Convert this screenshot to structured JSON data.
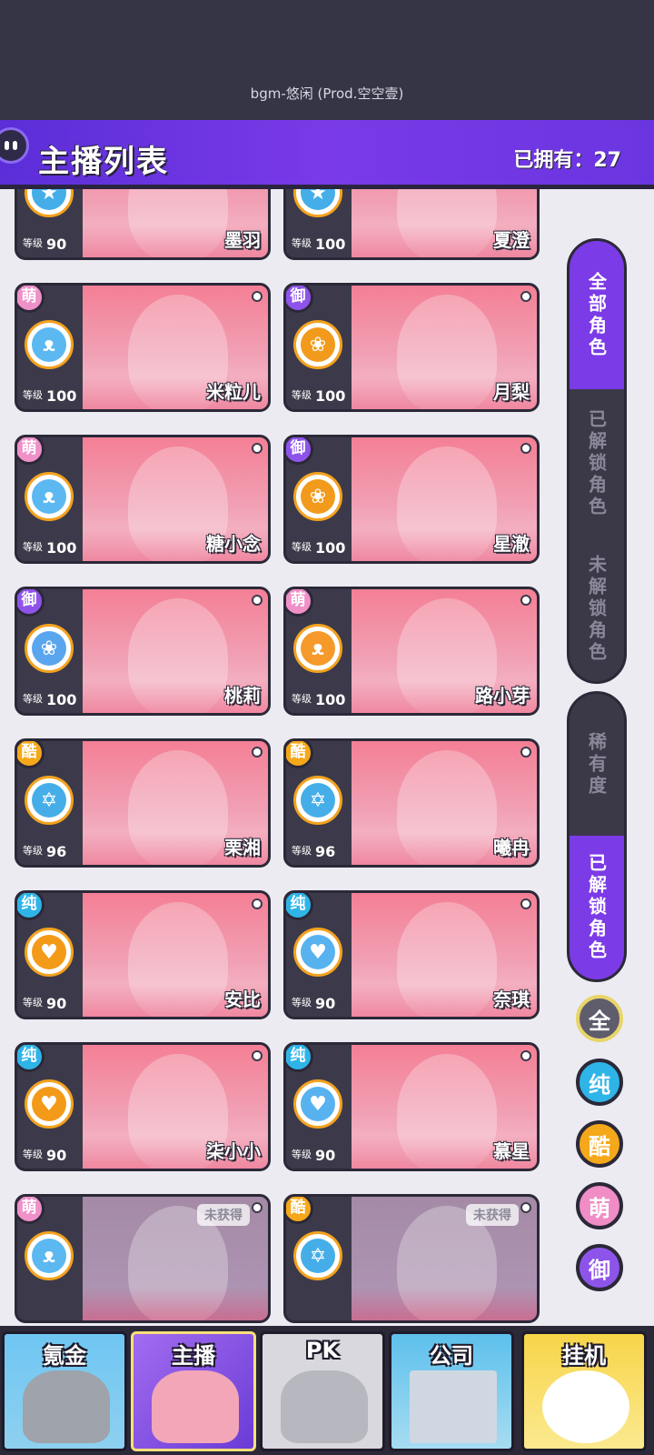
{
  "bgm": "bgm-悠闲 (Prod.空空壹)",
  "header": {
    "title": "主播列表",
    "owned": "已拥有：27"
  },
  "level_label": "等级",
  "unobtained_label": "未获得",
  "cards": [
    {
      "name": "墨羽",
      "level": "90",
      "rarity": "",
      "glyph": ""
    },
    {
      "name": "夏澄",
      "level": "100",
      "rarity": "",
      "glyph": ""
    },
    {
      "name": "米粒儿",
      "level": "100",
      "rarity": "萌",
      "glyph": "cat-icon"
    },
    {
      "name": "月梨",
      "level": "100",
      "rarity": "御",
      "glyph": "rose-icon"
    },
    {
      "name": "糖小念",
      "level": "100",
      "rarity": "萌",
      "glyph": "cat-icon"
    },
    {
      "name": "星澈",
      "level": "100",
      "rarity": "御",
      "glyph": "rose-icon"
    },
    {
      "name": "桃莉",
      "level": "100",
      "rarity": "御",
      "glyph": "rose-icon"
    },
    {
      "name": "路小芽",
      "level": "100",
      "rarity": "萌",
      "glyph": "cat-icon"
    },
    {
      "name": "栗湘",
      "level": "96",
      "rarity": "酷",
      "glyph": "star-icon"
    },
    {
      "name": "曦冉",
      "level": "96",
      "rarity": "酷",
      "glyph": "star-icon"
    },
    {
      "name": "安比",
      "level": "90",
      "rarity": "纯",
      "glyph": "heart-icon"
    },
    {
      "name": "奈琪",
      "level": "90",
      "rarity": "纯",
      "glyph": "heart-icon"
    },
    {
      "name": "柒小小",
      "level": "90",
      "rarity": "纯",
      "glyph": "heart-icon"
    },
    {
      "name": "慕星",
      "level": "90",
      "rarity": "纯",
      "glyph": "heart-icon"
    },
    {
      "name": "",
      "level": "",
      "rarity": "萌",
      "glyph": "cat-icon",
      "locked": true
    },
    {
      "name": "",
      "level": "",
      "rarity": "酷",
      "glyph": "star-icon",
      "locked": true
    }
  ],
  "filters": {
    "ownership": [
      "全部角色",
      "已解锁角色",
      "未解锁角色"
    ],
    "sort": [
      "稀有度",
      "已解锁角色"
    ],
    "rarity": [
      "全",
      "纯",
      "酷",
      "萌",
      "御"
    ]
  },
  "nav": [
    "氪金",
    "主播",
    "PK",
    "公司",
    "挂机"
  ]
}
